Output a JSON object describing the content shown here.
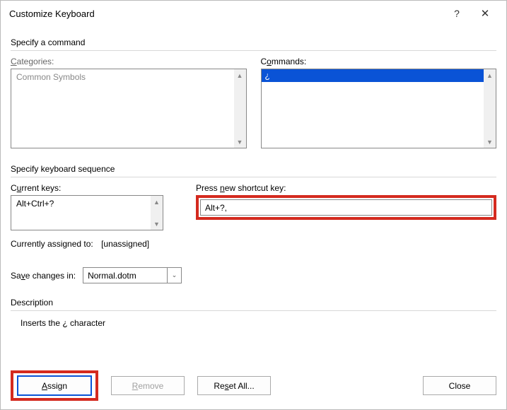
{
  "title": "Customize Keyboard",
  "section_command": "Specify a command",
  "labels": {
    "categories": "Categories:",
    "commands": "Commands:",
    "sequence": "Specify keyboard sequence",
    "current_keys": "Current keys:",
    "press_new": "Press new shortcut key:",
    "assigned_to": "Currently assigned to:",
    "save_in": "Save changes in:",
    "description": "Description"
  },
  "categories": {
    "items": [
      "Common Symbols"
    ]
  },
  "commands": {
    "items": [
      "¿"
    ]
  },
  "current_keys": {
    "items": [
      "Alt+Ctrl+?"
    ]
  },
  "shortcut_value": "Alt+?,",
  "assigned_value": "[unassigned]",
  "save_in_value": "Normal.dotm",
  "description_text": "Inserts the ¿ character",
  "buttons": {
    "assign": "Assign",
    "remove": "Remove",
    "reset": "Reset All...",
    "close": "Close"
  }
}
